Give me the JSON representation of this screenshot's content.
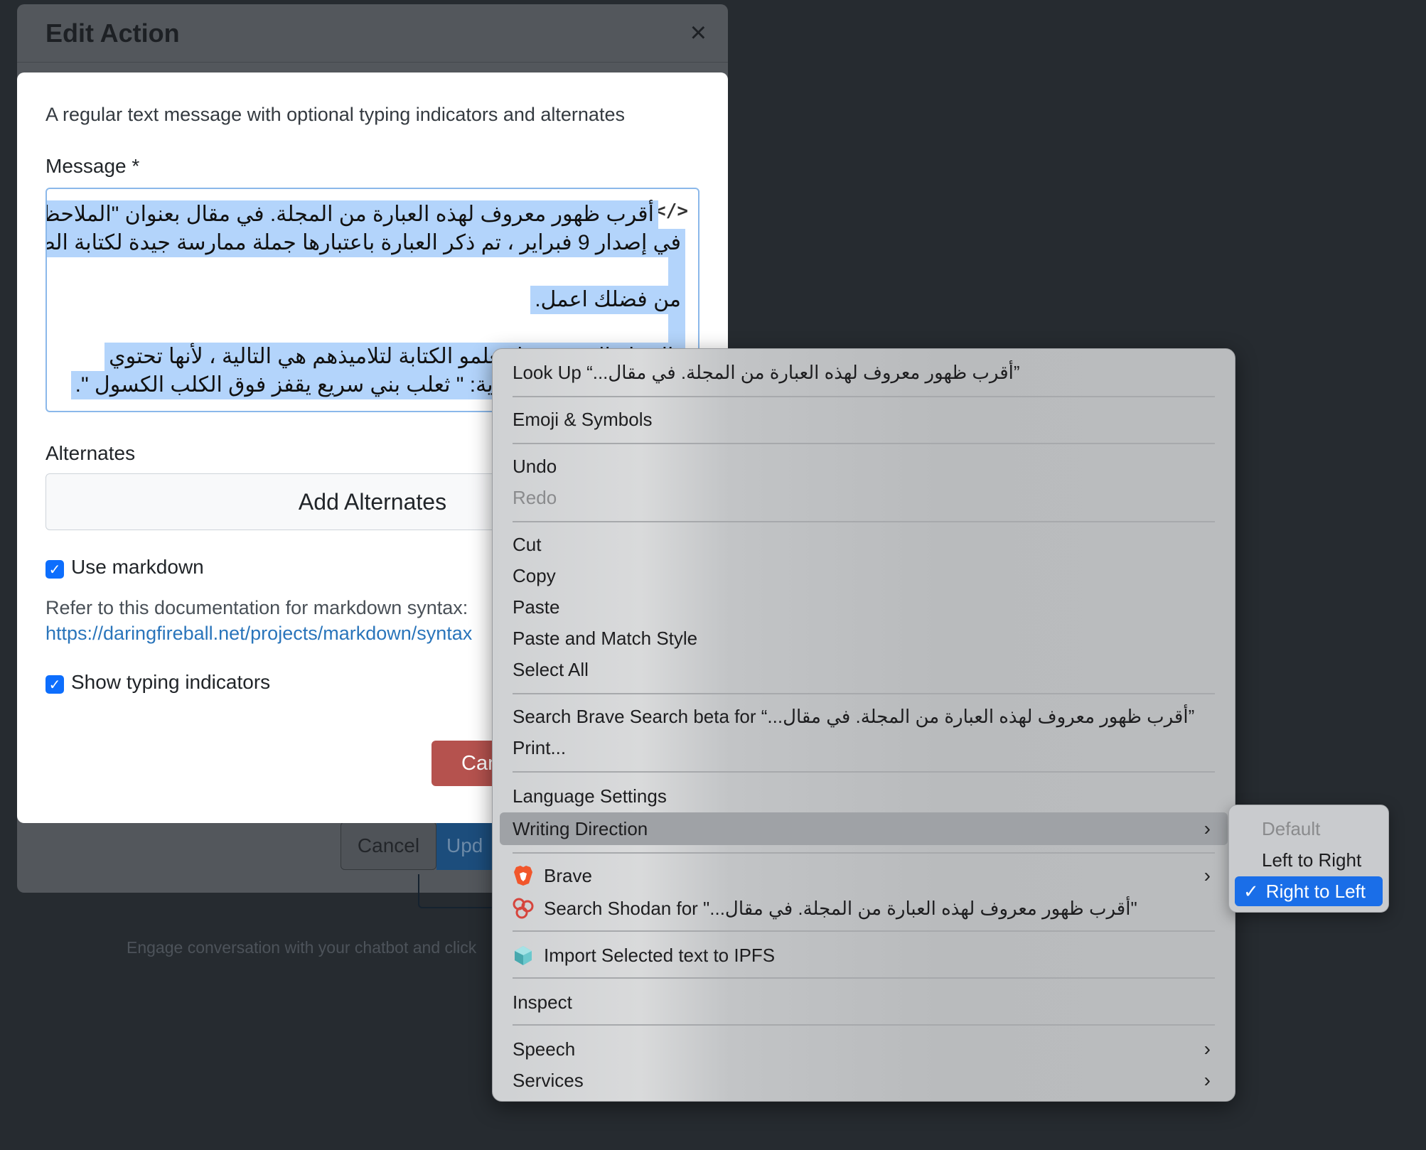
{
  "background_modal": {
    "title": "Edit Action",
    "close_glyph": "×",
    "cancel_label": "Cancel",
    "update_label": "Upd",
    "hint_text": "Engage conversation with your chatbot and click"
  },
  "modal": {
    "description": "A regular text message with optional typing indicators and alternates",
    "message_label": "Message *",
    "code_toggle": "</>",
    "message_lines": [
      "أقرب ظهور معروف لهذه العبارة من المجلة. في مقال بعنوان \"الملاحظات الحالية\"",
      "في إصدار 9 فبراير ، تم ذكر العبارة باعتبارها جملة ممارسة جيدة لكتابة الطلاب:",
      "من فضلك اعمل.",
      "\"الجملة التي يضعها معلمو الكتابة لتلاميذهم هي التالية ، لأنها تحتوي",
      "على كل حروف الأبجدية: \" ثعلب بني سريع يقفز فوق الكلب الكسول \"."
    ],
    "alternates_label": "Alternates",
    "add_alternates_label": "Add Alternates",
    "use_markdown_label": "Use markdown",
    "doc_text": "Refer to this documentation for markdown syntax:",
    "doc_link": "https://daringfireball.net/projects/markdown/syntax",
    "typing_indicators_label": "Show typing indicators",
    "cancel_label": "Cancel"
  },
  "context_menu": {
    "look_up_prefix": "Look Up “",
    "look_up_query": "أقرب ظهور معروف لهذه العبارة من المجلة. في مقال...",
    "look_up_suffix": "”",
    "emoji": "Emoji & Symbols",
    "undo": "Undo",
    "redo": "Redo",
    "cut": "Cut",
    "copy": "Copy",
    "paste": "Paste",
    "paste_match": "Paste and Match Style",
    "select_all": "Select All",
    "search_brave_prefix": "Search Brave Search beta for “",
    "search_brave_query": "أقرب ظهور معروف لهذه العبارة من المجلة. في مقال...",
    "search_brave_suffix": "”",
    "print": "Print...",
    "language_settings": "Language Settings",
    "writing_direction": "Writing Direction",
    "brave": "Brave",
    "search_shodan_prefix": "Search Shodan for \"",
    "search_shodan_query": "أقرب ظهور معروف لهذه العبارة من المجلة. في مقال...",
    "search_shodan_suffix": "\"",
    "import_ipfs": "Import Selected text to IPFS",
    "inspect": "Inspect",
    "speech": "Speech",
    "services": "Services",
    "chevron": "›"
  },
  "writing_direction_submenu": {
    "default": "Default",
    "ltr": "Left to Right",
    "rtl": "Right to Left",
    "checkmark": "✓"
  },
  "colors": {
    "accent": "#1a6ee8",
    "selection": "#b3d4fb",
    "danger": "#b5524e",
    "link": "#2a75bb"
  }
}
